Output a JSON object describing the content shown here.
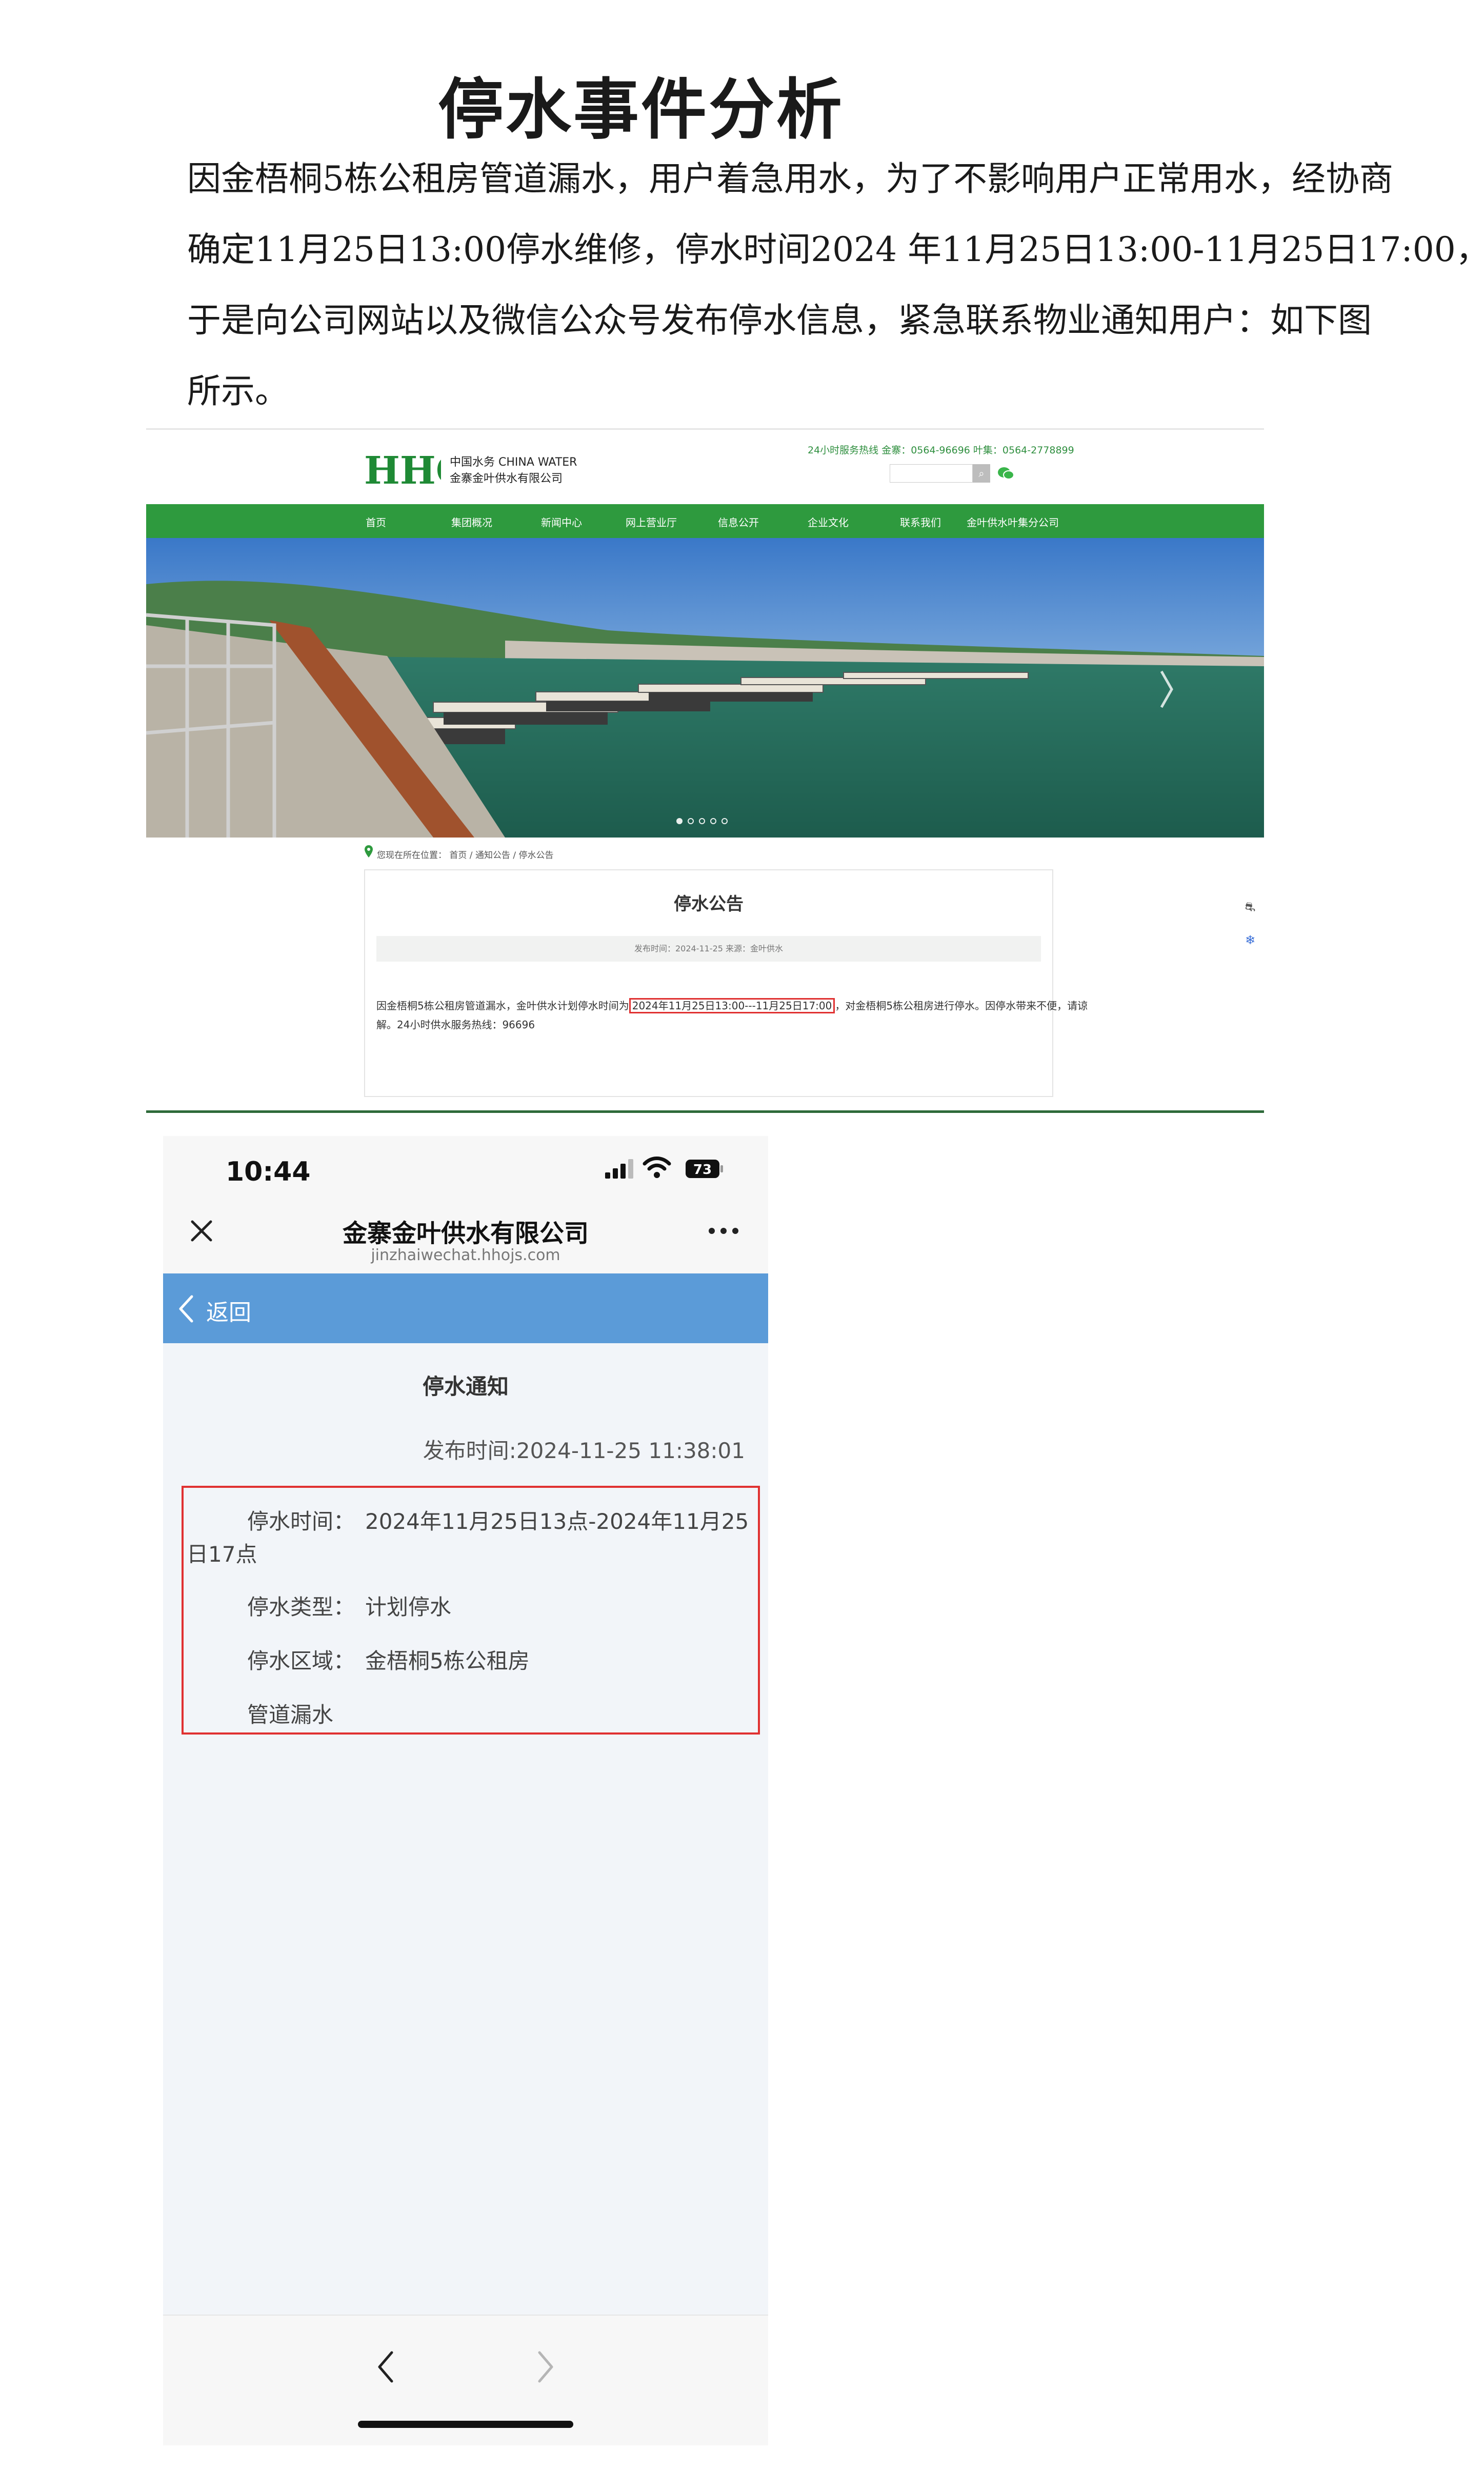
{
  "document": {
    "title": "停水事件分析",
    "paragraph_lines": [
      "因金梧桐5栋公租房管道漏水，用户着急用水，为了不影响用户正常用水，经协商",
      "确定11月25日13:00停水维修，停水时间2024 年11月25日13:00-11月25日17:00，",
      "于是向公司网站以及微信公众号发布停水信息，紧急联系物业通知用户：如下图",
      "所示。"
    ]
  },
  "website": {
    "logo_text": "HHO",
    "logo_line1": "中国水务 CHINA WATER",
    "logo_line2": "金寨金叶供水有限公司",
    "hotline": "24小时服务热线 金寨：0564-96696 叶集：0564-2778899",
    "search_button": "⌕",
    "nav": [
      "首页",
      "集团概况",
      "新闻中心",
      "网上营业厅",
      "信息公开",
      "企业文化",
      "联系我们",
      "金叶供水叶集分公司"
    ],
    "breadcrumb": "您现在所在位置： 首页 / 通知公告 / 停水公告",
    "notice": {
      "title": "停水公告",
      "meta": "发布时间：2024-11-25    来源：金叶供水",
      "body_before": "因金梧桐5栋公租房管道漏水，金叶供水计划停水时间为",
      "body_highlight": "2024年11月25日13:00---11月25日17:00",
      "body_after": "，对金梧桐5栋公租房进行停水。因停水带来不便，请谅",
      "body_line2": "解。24小时供水服务热线：96696"
    },
    "side_icon_top": "⛐",
    "side_icon_bottom": "❄",
    "colors": {
      "nav_green": "#2e9a3e",
      "highlight_red": "#e03131"
    }
  },
  "phone": {
    "time": "10:44",
    "battery": "73",
    "mp_title": "金寨金叶供水有限公司",
    "mp_domain": "jinzhaiwechat.hhojs.com",
    "back_label": "返回",
    "notice_title": "停水通知",
    "publish_time": "发布时间:2024-11-25 11:38:01",
    "outage_time_label": "停水时间：",
    "outage_time_value": "2024年11月25日13点-2024年11月25",
    "outage_time_wrap": "日17点",
    "outage_type_label": "停水类型：",
    "outage_type_value": "计划停水",
    "outage_area_label": "停水区域：",
    "outage_area_value": "金梧桐5栋公租房",
    "outage_reason": "管道漏水",
    "colors": {
      "back_bar": "#5b9bd8",
      "highlight_red": "#e03131"
    }
  }
}
